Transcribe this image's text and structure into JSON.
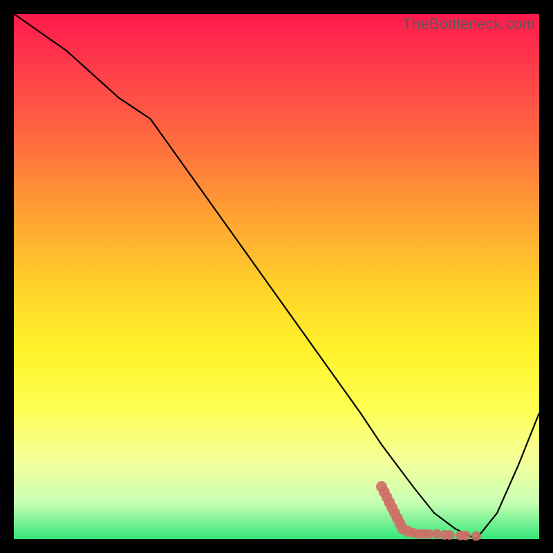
{
  "watermark": "TheBottleneck.com",
  "colors": {
    "gradient_top": "#ff1a4d",
    "gradient_bottom": "#33e67a",
    "curve": "#000000",
    "scatter": "#cf6e67",
    "frame": "#000000"
  },
  "chart_data": {
    "type": "line",
    "title": "",
    "xlabel": "",
    "ylabel": "",
    "xlim": [
      0,
      100
    ],
    "ylim": [
      0,
      100
    ],
    "series": [
      {
        "name": "bottleneck-curve",
        "x": [
          0,
          10,
          20,
          26,
          36,
          46,
          56,
          66,
          70,
          73,
          76,
          80,
          84,
          88,
          92,
          96,
          100
        ],
        "values": [
          100,
          93,
          84,
          80,
          66,
          52,
          38,
          24,
          18,
          14,
          10,
          5,
          2,
          0,
          5,
          14,
          24
        ]
      }
    ],
    "scatter": {
      "name": "bottleneck-scatter",
      "points": [
        {
          "x": 70,
          "y": 10
        },
        {
          "x": 70.5,
          "y": 9
        },
        {
          "x": 71,
          "y": 8
        },
        {
          "x": 71.5,
          "y": 7
        },
        {
          "x": 72,
          "y": 6
        },
        {
          "x": 72.5,
          "y": 5
        },
        {
          "x": 73,
          "y": 4
        },
        {
          "x": 73.5,
          "y": 3
        },
        {
          "x": 74,
          "y": 2
        },
        {
          "x": 75,
          "y": 1.5
        },
        {
          "x": 76,
          "y": 1.2
        },
        {
          "x": 77,
          "y": 1
        },
        {
          "x": 78,
          "y": 1
        },
        {
          "x": 79,
          "y": 1
        },
        {
          "x": 80.5,
          "y": 1
        },
        {
          "x": 82,
          "y": 0.8
        },
        {
          "x": 83,
          "y": 0.8
        },
        {
          "x": 85,
          "y": 0.7
        },
        {
          "x": 86,
          "y": 0.7
        },
        {
          "x": 88,
          "y": 0.6
        }
      ]
    }
  }
}
